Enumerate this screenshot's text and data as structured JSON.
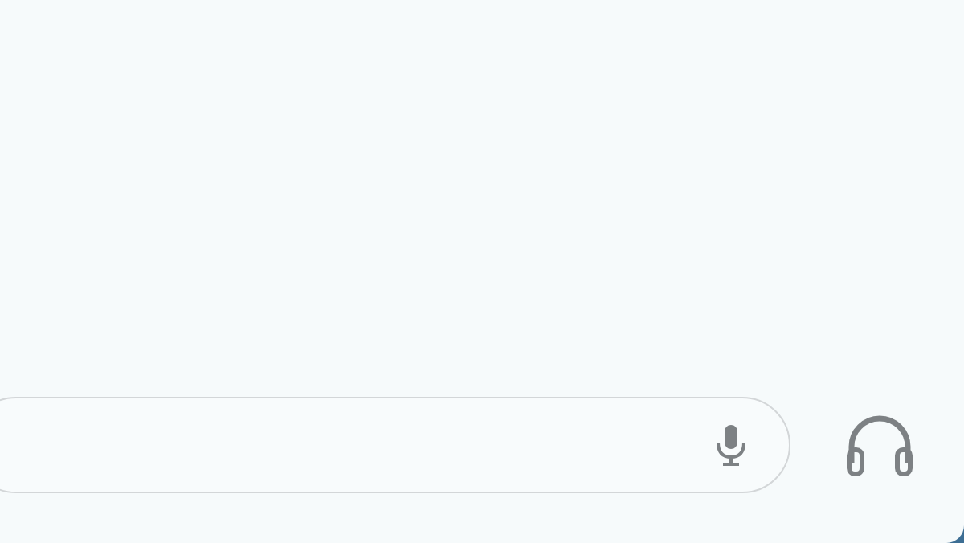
{
  "search_bar": {
    "kind": "voice"
  },
  "actions": [
    {
      "kind": "headphones"
    }
  ]
}
